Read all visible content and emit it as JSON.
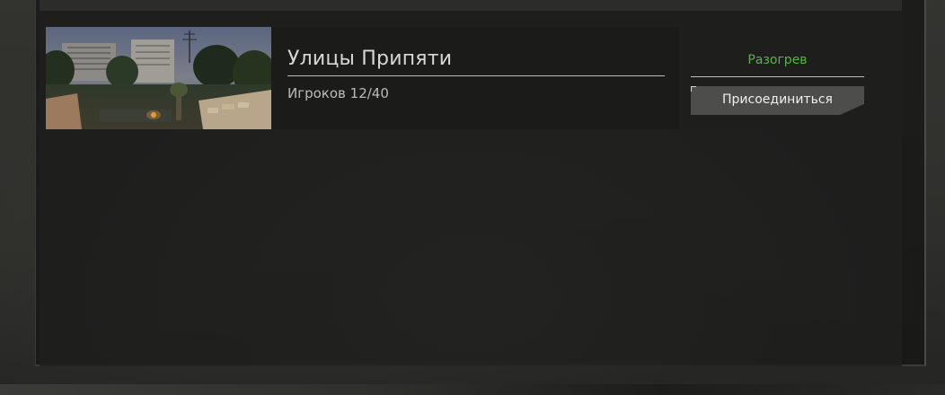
{
  "server": {
    "name": "Улицы Припяти",
    "players": "Игроков 12/40",
    "status": "Разогрев",
    "join_label": "Присоединиться",
    "status_color": "#5fae4e"
  },
  "thumbnail": {
    "icon": "map-preview-image"
  }
}
